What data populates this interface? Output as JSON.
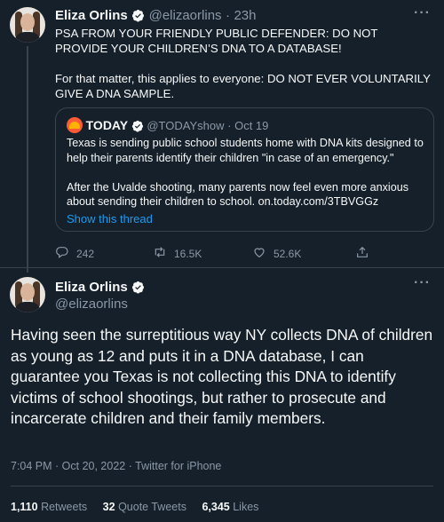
{
  "tweet1": {
    "author_name": "Eliza Orlins",
    "author_handle": "@elizaorlins",
    "time": "23h",
    "sep": "·",
    "more": "···",
    "paragraphs": [
      "PSA FROM YOUR FRIENDLY PUBLIC DEFENDER: DO NOT PROVIDE YOUR CHILDREN’S DNA TO A DATABASE!",
      "For that matter, this applies to everyone: DO NOT EVER VOLUNTARILY GIVE A DNA SAMPLE."
    ],
    "quote": {
      "author_name": "TODAY",
      "author_handle": "@TODAYshow",
      "date": "Oct 19",
      "paragraphs": [
        "Texas is sending public school students home with DNA kits designed to help their parents identify their children \"in case of an emergency.\"",
        "After the Uvalde shooting, many parents now feel even more anxious about sending their children to school.  on.today.com/3TBVGGz"
      ],
      "show_thread": "Show this thread"
    },
    "actions": {
      "replies": "242",
      "retweets": "16.5K",
      "likes": "52.6K"
    }
  },
  "tweet2": {
    "author_name": "Eliza Orlins",
    "author_handle": "@elizaorlins",
    "more": "···",
    "body": "Having seen the surreptitious way NY collects DNA of children as young as 12 and puts it in a DNA database, I can guarantee you Texas is not collecting this DNA to identify victims of school shootings, but rather to prosecute and incarcerate children and their family members.",
    "meta": "7:04 PM · Oct 20, 2022 · Twitter for iPhone",
    "stats": {
      "retweets_count": "1,110",
      "retweets_label": "Retweets",
      "quotes_count": "32",
      "quotes_label": "Quote Tweets",
      "likes_count": "6,345",
      "likes_label": "Likes"
    }
  },
  "colors": {
    "background": "#15202b",
    "text": "#f7f9f9",
    "secondary": "#8b98a5",
    "link": "#1d9bf0",
    "verified": "#1d9bf0",
    "border": "#38444d"
  }
}
